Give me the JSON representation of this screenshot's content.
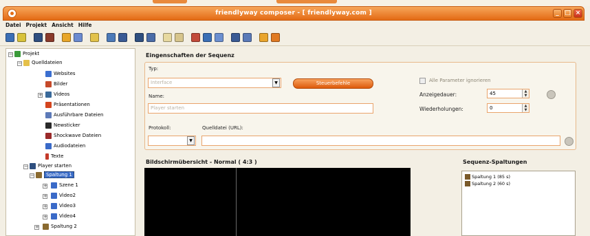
{
  "window": {
    "title": "friendlyway composer - [ friendlyway.com ]",
    "buttons": {
      "minimize": "_",
      "maximize": "□",
      "close": "×"
    }
  },
  "menu": [
    "Datei",
    "Projekt",
    "Ansicht",
    "Hilfe"
  ],
  "tree": {
    "items": [
      {
        "label": "Projekt",
        "icon": "project-icon"
      },
      {
        "label": "Quelldateien",
        "icon": "folder-icon"
      },
      {
        "label": "Websites",
        "icon": "globe-icon"
      },
      {
        "label": "Bilder",
        "icon": "pictures-icon"
      },
      {
        "label": "Videos",
        "icon": "video-icon"
      },
      {
        "label": "Präsentationen",
        "icon": "presentation-icon"
      },
      {
        "label": "Ausführbare Dateien",
        "icon": "executable-icon"
      },
      {
        "label": "Newsticker",
        "icon": "newsticker-icon"
      },
      {
        "label": "Shockwave Dateien",
        "icon": "shockwave-icon"
      },
      {
        "label": "Audiodateien",
        "icon": "audio-icon"
      },
      {
        "label": "Texte",
        "icon": "text-icon"
      },
      {
        "label": "Player starten",
        "icon": "player-icon"
      },
      {
        "label": "Spaltung 1",
        "icon": "split-icon"
      },
      {
        "label": "Szene 1",
        "icon": "scene-icon"
      },
      {
        "label": "Video2",
        "icon": "scene-icon"
      },
      {
        "label": "Video3",
        "icon": "scene-icon"
      },
      {
        "label": "Video4",
        "icon": "scene-icon"
      },
      {
        "label": "Spaltung 2",
        "icon": "split-icon"
      }
    ]
  },
  "properties": {
    "heading": "Eingenschaften der Sequenz",
    "type_label": "Typ:",
    "type_value": "Interface",
    "control_button": "Steuerbefehle",
    "name_label": "Name:",
    "name_placeholder": "Player starten",
    "ignore_params_label": "Alle Parameter ignorieren",
    "display_duration_label": "Anzeigedauer:",
    "display_duration_value": "45",
    "repetitions_label": "Wiederholungen:",
    "repetitions_value": "0",
    "protocol_label": "Protokoll:",
    "source_file_label": "Quelldatei (URL):"
  },
  "preview": {
    "heading": "Bildschirmübersicht - Normal ( 4:3 )"
  },
  "sequence_splits": {
    "heading": "Sequenz-Spaltungen",
    "items": [
      "Spaltung 1 (85 s)",
      "Spaltung 2 (60 s)"
    ]
  }
}
